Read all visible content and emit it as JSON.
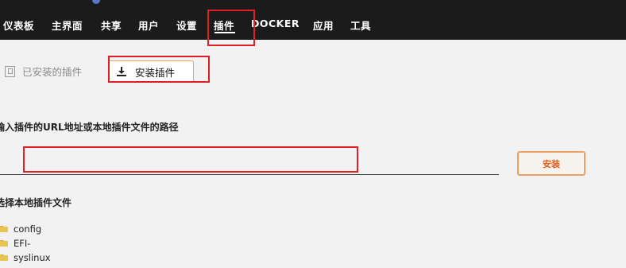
{
  "nav": {
    "items": [
      "仪表板",
      "主界面",
      "共享",
      "用户",
      "设置",
      "插件",
      "DOCKER",
      "应用",
      "工具"
    ],
    "active": "插件"
  },
  "tabs": {
    "installed_label": "已安装的插件",
    "install_label": "安装插件"
  },
  "install": {
    "url_label": "输入插件的URL地址或本地插件文件的路径",
    "url_value": "",
    "button_label": "安装"
  },
  "local": {
    "label": "选择本地插件文件",
    "files": [
      "config",
      "EFI-",
      "syslinux"
    ]
  },
  "colors": {
    "topbar": "#1c1b1b",
    "highlight": "#e01e25",
    "accent": "#e85c15"
  },
  "icons": {
    "installed_tab": "plugin-icon",
    "install_tab": "download-icon",
    "file": "folder-icon"
  }
}
